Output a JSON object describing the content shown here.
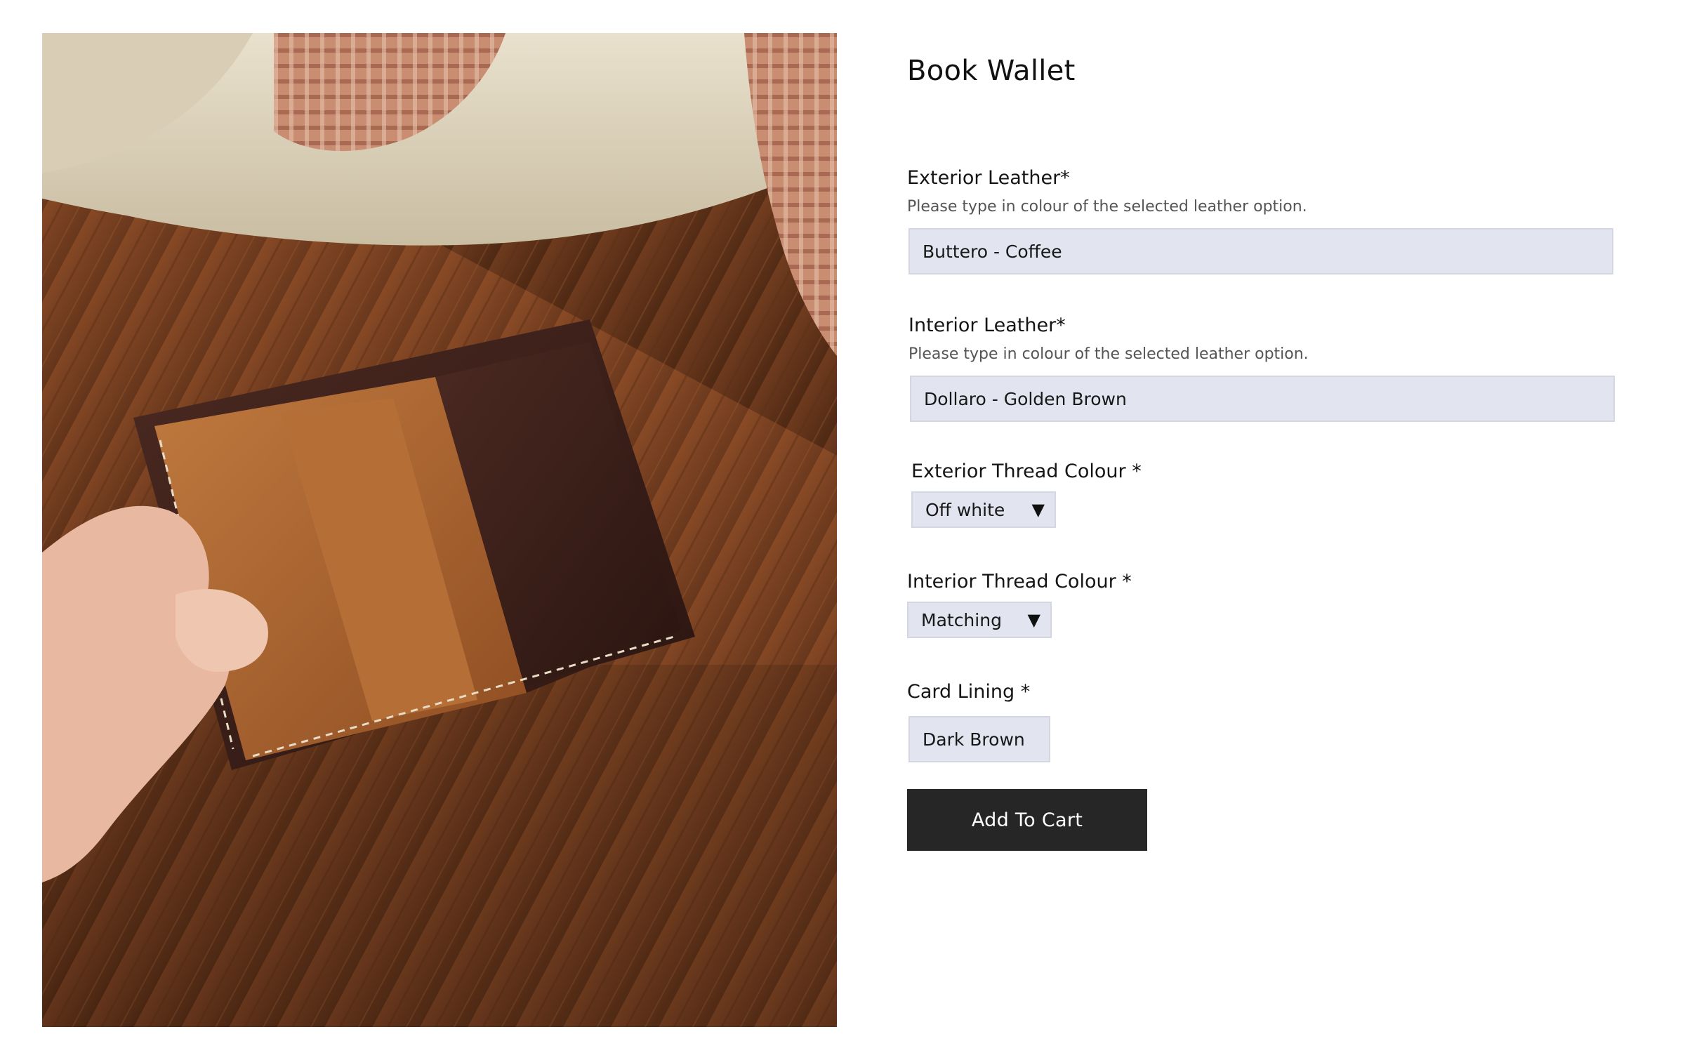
{
  "product": {
    "title": "Book Wallet"
  },
  "form": {
    "exterior_leather": {
      "label": "Exterior Leather*",
      "hint": "Please type in colour of the selected leather option.",
      "value": "Buttero - Coffee"
    },
    "interior_leather": {
      "label": "Interior Leather*",
      "hint": "Please type in colour of the selected leather option.",
      "value": "Dollaro - Golden Brown"
    },
    "exterior_thread": {
      "label": "Exterior Thread Colour *",
      "selected": "Off white"
    },
    "interior_thread": {
      "label": "Interior Thread Colour *",
      "selected": "Matching"
    },
    "card_lining": {
      "label": "Card Lining *",
      "value": "Dark Brown"
    },
    "add_to_cart_label": "Add To Cart"
  },
  "icons": {
    "dropdown": "chevron-down-icon"
  },
  "colors": {
    "field_background": "#e2e5ef",
    "button_background": "#262626",
    "button_text": "#ffffff"
  }
}
